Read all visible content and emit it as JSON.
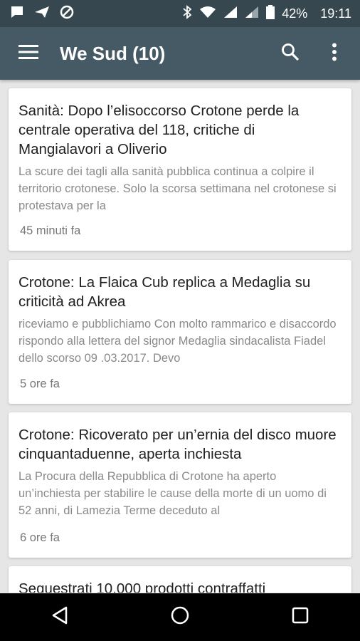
{
  "status_bar": {
    "battery": "42%",
    "time": "19:11",
    "icons": [
      "notification-icon",
      "send-icon",
      "blocked-icon",
      "bluetooth-icon",
      "wifi-icon",
      "signal-icon",
      "battery-icon"
    ]
  },
  "app_bar": {
    "title": "We Sud (10)",
    "icons": [
      "menu-icon",
      "search-icon",
      "more-vert-icon"
    ]
  },
  "articles": [
    {
      "title": "Sanità: Dopo l’elisoccorso Crotone perde la centrale operativa del 118, critiche di Mangialavori a Oliverio",
      "description": "La scure dei tagli alla sanità pubblica continua a colpire il territorio crotonese. Solo la scorsa settimana nel crotonese si protestava per la",
      "time": "45 minuti fa"
    },
    {
      "title": "Crotone: La Flaica Cub replica a Medaglia su criticità ad Akrea",
      "description": "riceviamo e pubblichiamo Con molto rammarico e disaccordo rispondo alla lettera del signor Medaglia sindacalista Fiadel dello scorso 09 .03.2017. Devo",
      "time": "5 ore fa"
    },
    {
      "title": "Crotone: Ricoverato per un’ernia del disco muore cinquantaduenne, aperta inchiesta",
      "description": "La Procura della Repubblica di Crotone ha aperto un’inchiesta per stabilire le cause della morte di un uomo di 52 anni, di Lamezia Terme deceduto al",
      "time": "6 ore fa"
    },
    {
      "title": "Sequestrati 10.000 prodotti contraffatti"
    }
  ],
  "nav_bar": {
    "icons": [
      "back-icon",
      "home-icon",
      "recents-icon"
    ]
  },
  "colors": {
    "status_bar": "#37474f",
    "app_bar": "#455a64",
    "background": "#e6e6e6",
    "title_text": "#212121",
    "desc_text": "#8a8a8a"
  }
}
